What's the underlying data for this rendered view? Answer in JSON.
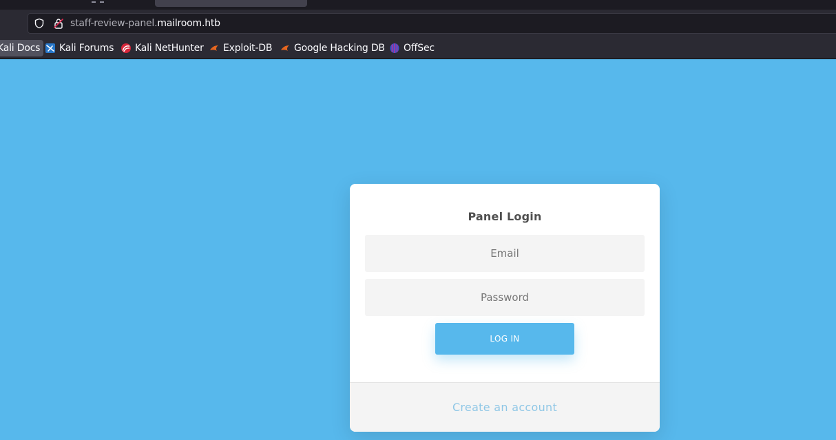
{
  "browser": {
    "url_subdomain": "staff-review-panel.",
    "url_domain": "mailroom.htb",
    "bookmarks": [
      {
        "label": "Kali Docs",
        "icon": "kali-docs-icon"
      },
      {
        "label": "Kali Forums",
        "icon": "kali-forums-icon"
      },
      {
        "label": "Kali NetHunter",
        "icon": "kali-nethunter-icon"
      },
      {
        "label": "Exploit-DB",
        "icon": "exploit-db-icon"
      },
      {
        "label": "Google Hacking DB",
        "icon": "google-hacking-db-icon"
      },
      {
        "label": "OffSec",
        "icon": "offsec-icon"
      }
    ]
  },
  "login": {
    "title": "Panel Login",
    "email_placeholder": "Email",
    "password_placeholder": "Password",
    "button_label": "LOG IN",
    "create_account_label": "Create an account"
  },
  "colors": {
    "page_background": "#57b8ec",
    "button": "#57b8ec",
    "link": "#8fc7e6"
  }
}
